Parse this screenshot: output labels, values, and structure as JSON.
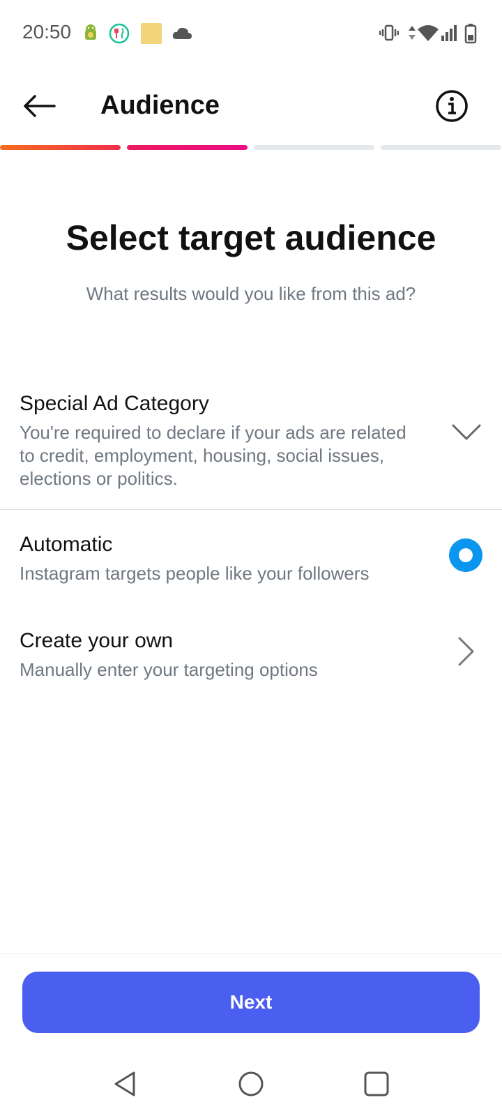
{
  "status_bar": {
    "time": "20:50",
    "icons": [
      "android-icon",
      "food-icon",
      "yellow-app-icon",
      "cloud-icon",
      "vibrate-icon",
      "data-arrows-icon",
      "wifi-icon",
      "signal-icon",
      "battery-icon"
    ]
  },
  "header": {
    "title": "Audience",
    "back_icon": "arrow-left-icon",
    "info_icon": "info-icon"
  },
  "progress": {
    "steps_total": 4,
    "steps_completed": 2,
    "colors": {
      "step1": "#f2453a",
      "step2": "#e9136d",
      "inactive": "#e6e9ec"
    }
  },
  "hero": {
    "title": "Select target audience",
    "subtitle": "What results would you like from this ad?"
  },
  "special_ad": {
    "title": "Special Ad Category",
    "description": "You're required to declare if your ads are related to credit, employment, housing, social issues, elections or politics.",
    "icon": "chevron-down-icon"
  },
  "options": {
    "automatic": {
      "title": "Automatic",
      "description": "Instagram targets people like your followers",
      "selected": true
    },
    "create_own": {
      "title": "Create your own",
      "description": "Manually enter your targeting options",
      "icon": "chevron-right-icon"
    }
  },
  "footer": {
    "next_label": "Next",
    "accent": "#4a5ef0"
  },
  "nav_bar": {
    "icons": [
      "nav-back-icon",
      "nav-home-icon",
      "nav-recents-icon"
    ]
  }
}
